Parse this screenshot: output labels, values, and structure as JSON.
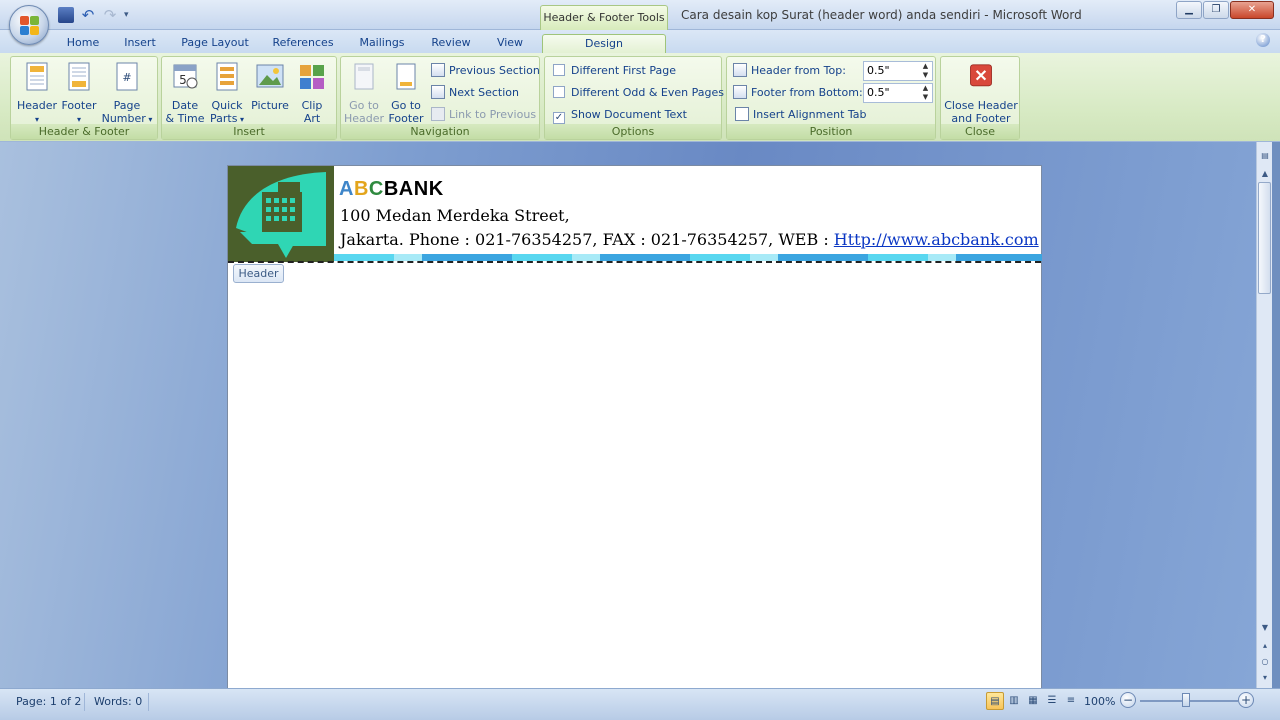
{
  "window": {
    "title": "Cara desain kop Surat (header word) anda sendiri - Microsoft Word",
    "context_tab": "Header & Footer Tools"
  },
  "tabs": [
    {
      "label": "Home"
    },
    {
      "label": "Insert"
    },
    {
      "label": "Page Layout"
    },
    {
      "label": "References"
    },
    {
      "label": "Mailings"
    },
    {
      "label": "Review"
    },
    {
      "label": "View"
    },
    {
      "label": "Design",
      "active": true
    }
  ],
  "ribbon": {
    "header_footer": {
      "group_label": "Header & Footer",
      "header": "Header",
      "footer": "Footer",
      "page_number_1": "Page",
      "page_number_2": "Number"
    },
    "insert": {
      "group_label": "Insert",
      "date_1": "Date",
      "date_2": "& Time",
      "quick_1": "Quick",
      "quick_2": "Parts",
      "picture": "Picture",
      "clip_1": "Clip",
      "clip_2": "Art"
    },
    "navigation": {
      "group_label": "Navigation",
      "goto_header_1": "Go to",
      "goto_header_2": "Header",
      "goto_footer_1": "Go to",
      "goto_footer_2": "Footer",
      "previous_section": "Previous Section",
      "next_section": "Next Section",
      "link_to_previous": "Link to Previous"
    },
    "options": {
      "group_label": "Options",
      "different_first_page": "Different First Page",
      "different_odd_even": "Different Odd & Even Pages",
      "show_document_text": "Show Document Text",
      "show_document_text_checked": true
    },
    "position": {
      "group_label": "Position",
      "header_from_top_label": "Header from Top:",
      "header_from_top_value": "0.5\"",
      "footer_from_bottom_label": "Footer from Bottom:",
      "footer_from_bottom_value": "0.5\"",
      "insert_alignment_tab": "Insert Alignment Tab"
    },
    "close": {
      "group_label": "Close",
      "close_1": "Close Header",
      "close_2": "and Footer"
    }
  },
  "document": {
    "company_a": "A",
    "company_b": "B",
    "company_c": "C",
    "company_rest": "BANK",
    "address_line1": "100 Medan Merdeka Street,",
    "address_line2_prefix": "Jakarta. Phone : 021-76354257, FAX : 021-76354257, WEB : ",
    "website": "Http://www.abcbank.com",
    "header_tag": "Header"
  },
  "statusbar": {
    "page": "Page: 1 of 2",
    "words": "Words: 0",
    "zoom": "100%"
  },
  "colors": {
    "logo_bg": "#4a5f2b",
    "logo_fg": "#2fd6b4",
    "ribbon_context": "#d7ebbb"
  }
}
